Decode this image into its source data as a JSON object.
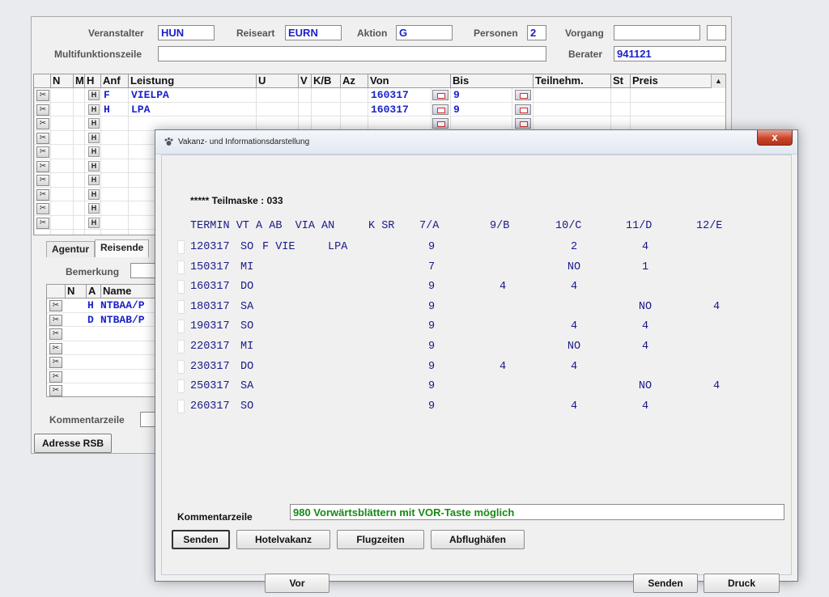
{
  "main": {
    "fields": {
      "veranstalter": {
        "label": "Veranstalter",
        "value": "HUN"
      },
      "reiseart": {
        "label": "Reiseart",
        "value": "EURN"
      },
      "aktion": {
        "label": "Aktion",
        "value": "G"
      },
      "personen": {
        "label": "Personen",
        "value": "2"
      },
      "vorgang": {
        "label": "Vorgang",
        "value": ""
      },
      "multifunktionszeile": {
        "label": "Multifunktionszeile",
        "value": ""
      },
      "berater": {
        "label": "Berater",
        "value": "941121"
      }
    },
    "grid": {
      "headers": [
        "N",
        "M",
        "H",
        "Anf",
        "Leistung",
        "U",
        "V",
        "K/B",
        "Az",
        "Von",
        "Bis",
        "Teilnehm.",
        "St",
        "Preis"
      ],
      "rows": [
        {
          "h": "H",
          "anf": "F",
          "leistung": "VIELPA",
          "von": "160317",
          "bis": "9"
        },
        {
          "h": "H",
          "anf": "H",
          "leistung": "LPA",
          "von": "160317",
          "bis": "9"
        },
        {
          "h": "H",
          "anf": "",
          "leistung": "",
          "von": "",
          "bis": ""
        },
        {
          "h": "H",
          "anf": "",
          "leistung": "",
          "von": "",
          "bis": ""
        },
        {
          "h": "H",
          "anf": "",
          "leistung": "",
          "von": "",
          "bis": ""
        },
        {
          "h": "H",
          "anf": "",
          "leistung": "",
          "von": "",
          "bis": ""
        },
        {
          "h": "H",
          "anf": "",
          "leistung": "",
          "von": "",
          "bis": ""
        },
        {
          "h": "H",
          "anf": "",
          "leistung": "",
          "von": "",
          "bis": ""
        },
        {
          "h": "H",
          "anf": "",
          "leistung": "",
          "von": "",
          "bis": ""
        },
        {
          "h": "H",
          "anf": "",
          "leistung": "",
          "von": "",
          "bis": ""
        }
      ]
    },
    "tabs": [
      "Agentur",
      "Reisende"
    ],
    "bemerkung_label": "Bemerkung",
    "reisende": {
      "headers": [
        "N",
        "A",
        "Name"
      ],
      "rows": [
        {
          "a": "H",
          "name": "NTBAA/P"
        },
        {
          "a": "D",
          "name": "NTBAB/P"
        },
        {
          "a": "",
          "name": ""
        },
        {
          "a": "",
          "name": ""
        },
        {
          "a": "",
          "name": ""
        },
        {
          "a": "",
          "name": ""
        },
        {
          "a": "",
          "name": ""
        }
      ]
    },
    "kommentarzeile_label": "Kommentarzeile",
    "adresse_button": "Adresse RSB"
  },
  "dialog": {
    "title": "Vakanz- und Informationsdarstellung",
    "close_glyph": "x",
    "teilmaske": "***** Teilmaske : 033",
    "columns": [
      "TERMIN VT A AB  VIA AN",
      "K SR",
      "7/A",
      "9/B",
      "10/C",
      "11/D",
      "12/E"
    ],
    "rows": [
      {
        "termin": "120317",
        "vt": "SO",
        "rest": "F VIE     LPA",
        "a7": "9",
        "b9": "",
        "c10": "2",
        "d11": "4",
        "e12": ""
      },
      {
        "termin": "150317",
        "vt": "MI",
        "rest": "",
        "a7": "7",
        "b9": "",
        "c10": "NO",
        "d11": "1",
        "e12": ""
      },
      {
        "termin": "160317",
        "vt": "DO",
        "rest": "",
        "a7": "9",
        "b9": "4",
        "c10": "4",
        "d11": "",
        "e12": ""
      },
      {
        "termin": "180317",
        "vt": "SA",
        "rest": "",
        "a7": "9",
        "b9": "",
        "c10": "",
        "d11": "NO",
        "e12": "4"
      },
      {
        "termin": "190317",
        "vt": "SO",
        "rest": "",
        "a7": "9",
        "b9": "",
        "c10": "4",
        "d11": "4",
        "e12": ""
      },
      {
        "termin": "220317",
        "vt": "MI",
        "rest": "",
        "a7": "9",
        "b9": "",
        "c10": "NO",
        "d11": "4",
        "e12": ""
      },
      {
        "termin": "230317",
        "vt": "DO",
        "rest": "",
        "a7": "9",
        "b9": "4",
        "c10": "4",
        "d11": "",
        "e12": ""
      },
      {
        "termin": "250317",
        "vt": "SA",
        "rest": "",
        "a7": "9",
        "b9": "",
        "c10": "",
        "d11": "NO",
        "e12": "4"
      },
      {
        "termin": "260317",
        "vt": "SO",
        "rest": "",
        "a7": "9",
        "b9": "",
        "c10": "4",
        "d11": "4",
        "e12": ""
      }
    ],
    "kommentarzeile_label": "Kommentarzeile",
    "kommentarzeile_value": "980 Vorwärtsblättern mit VOR-Taste möglich",
    "buttons": {
      "senden": "Senden",
      "hotelvakanz": "Hotelvakanz",
      "flugzeiten": "Flugzeiten",
      "abflughaefen": "Abflughäfen",
      "vor": "Vor",
      "senden2": "Senden",
      "druck": "Druck"
    }
  }
}
